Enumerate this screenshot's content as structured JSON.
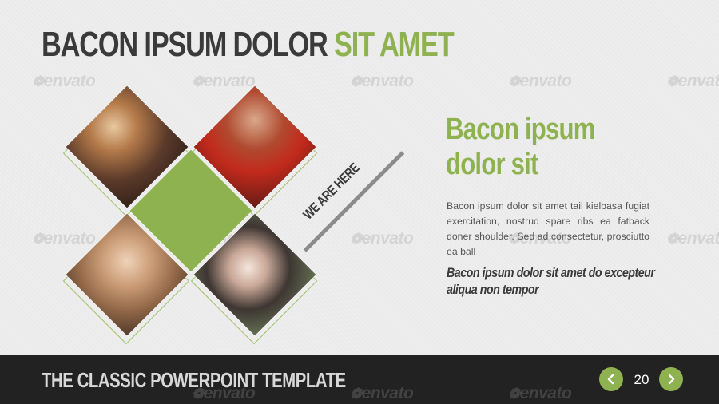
{
  "slide": {
    "title_main": "BACON IPSUM DOLOR ",
    "title_accent": "SIT AMET"
  },
  "tag": "WE ARE HERE",
  "content": {
    "heading": "Bacon ipsum dolor sit",
    "body": "Bacon ipsum dolor sit amet tail kielbasa fugiat exercitation, nostrud spare ribs ea fatback doner shoulder. Sed ad consectetur, prosciutto ea ball",
    "italic": "Bacon ipsum dolor sit amet do excepteur aliqua non tempor"
  },
  "footer": {
    "title": "THE CLASSIC POWERPOINT TEMPLATE",
    "page_number": "20"
  },
  "watermark": {
    "text": "envato"
  },
  "icons": {
    "prev": "chevron-left-icon",
    "next": "chevron-right-icon"
  },
  "colors": {
    "accent": "#8db24f",
    "title": "#3a3a3a",
    "footer_bg": "#222222"
  }
}
